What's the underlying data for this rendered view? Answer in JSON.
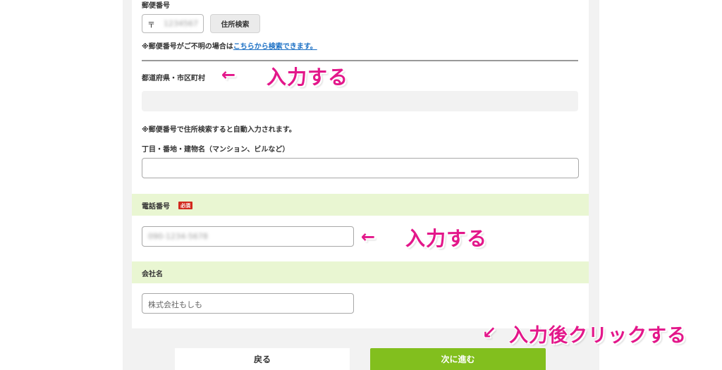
{
  "form": {
    "postal": {
      "label": "郵便番号",
      "mark": "〒",
      "value": "1234567",
      "search_button": "住所検索",
      "note_prefix": "※郵便番号がご不明の場合は",
      "note_link": "こちらから検索できます。"
    },
    "prefecture_city": {
      "label": "都道府県・市区町村",
      "value": ""
    },
    "auto_note": "※郵便番号で住所検索すると自動入力されます。",
    "street": {
      "label": "丁目・番地・建物名（マンション、ビルなど）",
      "value": ""
    },
    "phone": {
      "label": "電話番号",
      "required_badge": "必須",
      "value": "090-1234-5678"
    },
    "company": {
      "label": "会社名",
      "placeholder": "株式会社もしも"
    }
  },
  "buttons": {
    "back": "戻る",
    "next": "次に進む"
  },
  "annotations": {
    "arrow_left": "←",
    "arrow_down_left": "↙",
    "input_text": "入力する",
    "click_text": "入力後クリックする",
    "color": "#e3178a"
  },
  "colors": {
    "accent_green": "#82bf1e",
    "section_band": "#e9f6d2",
    "required_red": "#d22a1e",
    "link_blue": "#1a6fc4"
  }
}
